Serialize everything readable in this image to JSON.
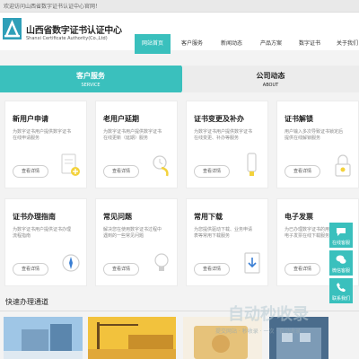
{
  "topbar": {
    "welcome": "欢迎访问山西省数字证书认证中心官网！"
  },
  "brand": {
    "name_cn": "山西省数字证书认证中心",
    "name_en": "Shanxi Certificate Authority(Co.,Ltd)"
  },
  "nav": {
    "items": [
      {
        "label": "网站首页",
        "active": true
      },
      {
        "label": "客户服务",
        "active": false
      },
      {
        "label": "新闻动态",
        "active": false
      },
      {
        "label": "产品方案",
        "active": false
      },
      {
        "label": "数字证书",
        "active": false
      },
      {
        "label": "关于我们",
        "active": false
      }
    ]
  },
  "tabs": {
    "service": {
      "label": "客户服务",
      "sub": "SERVICE"
    },
    "about": {
      "label": "公司动态",
      "sub": "ABOUT"
    }
  },
  "cards": [
    {
      "title": "新用户申请",
      "desc": "为数字证书用户提供数字证书在线申请服务",
      "button": "查看详情",
      "icon": "document-plus-icon"
    },
    {
      "title": "老用户延期",
      "desc": "为数字证书用户提供数字证书在线更新（延期）服务",
      "button": "查看详情",
      "icon": "renew-icon"
    },
    {
      "title": "证书变更及补办",
      "desc": "为数字证书用户提供数字证书在线变更、补办等服务",
      "button": "查看详情",
      "icon": "usb-key-icon"
    },
    {
      "title": "证书解锁",
      "desc": "用户输入多次导致证书锁定后提供在线解锁服务",
      "button": "查看详情",
      "icon": "lock-icon"
    },
    {
      "title": "证书办理指南",
      "desc": "为数字证书用户提供证书办理流程指南",
      "button": "查看详情",
      "icon": "compass-icon"
    },
    {
      "title": "常见问题",
      "desc": "解决您在使用数字证书过程中遇到的一些常见问题",
      "button": "查看详情",
      "icon": "lightbulb-icon"
    },
    {
      "title": "常用下载",
      "desc": "为您提供驱动下载、业务申请表等常用下载服务",
      "button": "查看详情",
      "icon": "download-icon"
    },
    {
      "title": "电子发票",
      "desc": "为已办理数字证书的用户提供电子发票在线下载服务",
      "button": "查看详情",
      "icon": "invoice-icon"
    }
  ],
  "side_tools": [
    {
      "label": "在线客服",
      "icon": "chat-icon"
    },
    {
      "label": "微信客服",
      "icon": "wechat-icon"
    },
    {
      "label": "联系我们",
      "icon": "phone-icon"
    }
  ],
  "quick": {
    "title": "快速办理通道"
  },
  "watermark": {
    "text": "自动秒收录",
    "sub": "提交网站 · 秒收录 · 一次 · 自动收录"
  },
  "colors": {
    "accent": "#3ac0bd",
    "topbar": "#e9e9e9",
    "card_border": "#ececec"
  }
}
